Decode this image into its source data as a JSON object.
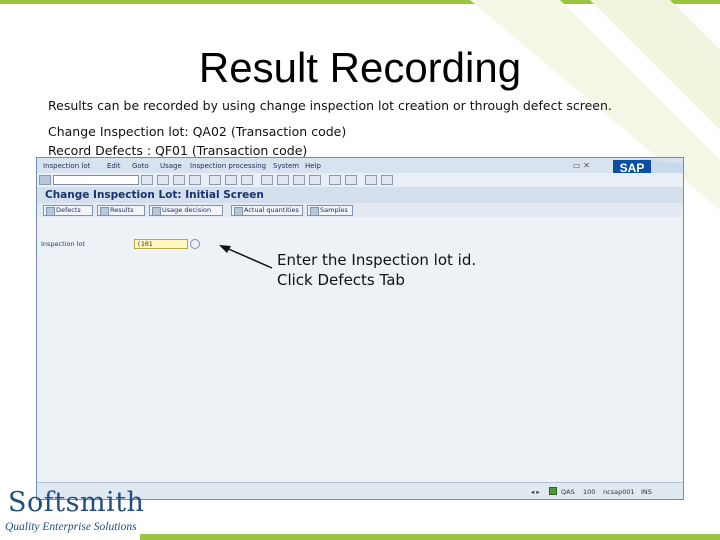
{
  "slide": {
    "title": "Result Recording",
    "line1": "Results can be recorded by using change inspection lot creation or through defect screen.",
    "line2": "Change Inspection lot: QA02 (Transaction code)",
    "line3": "Record Defects : QF01 (Transaction code)"
  },
  "sap": {
    "menu": [
      "Inspection lot",
      "Edit",
      "Goto",
      "Usage",
      "Inspection processing",
      "System",
      "Help"
    ],
    "logo": "SAP",
    "screen_title": "Change Inspection Lot: Initial Screen",
    "app_buttons": [
      "Defects",
      "Results",
      "Usage decision",
      "Actual quantities",
      "Samples"
    ],
    "field_label": "Inspection lot",
    "field_value": "(101",
    "status": {
      "system": "QAS",
      "client": "100",
      "server": "ncsap001",
      "mode": "INS"
    }
  },
  "callout": {
    "line1": "Enter the Inspection lot id.",
    "line2": "Click Defects Tab"
  },
  "logo": {
    "name": "Softsmith",
    "tagline": "Quality Enterprise Solutions"
  },
  "colors": {
    "accent_green": "#9bc53d",
    "sap_title": "#1b3270",
    "logo_blue": "#1f4f80"
  }
}
